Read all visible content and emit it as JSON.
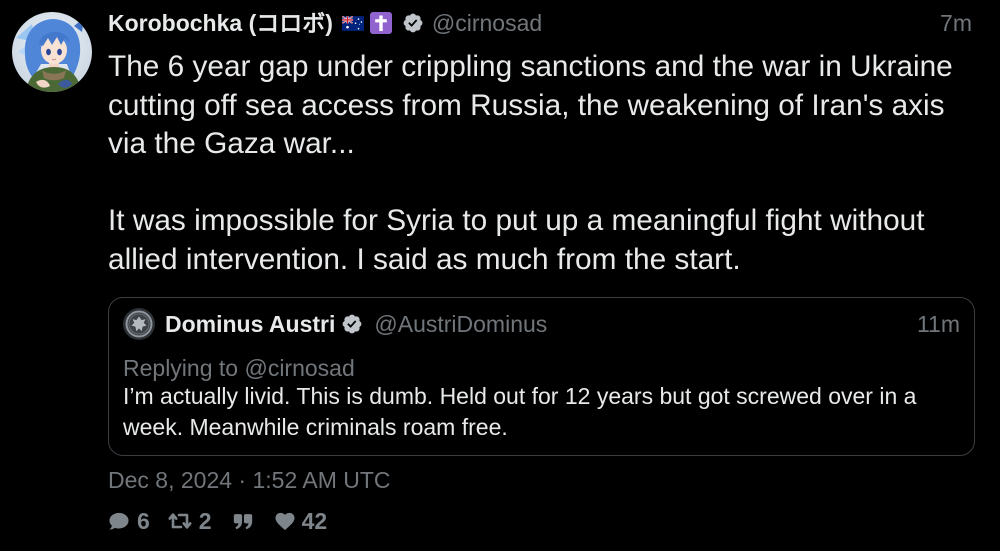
{
  "colors": {
    "background": "#000000",
    "text": "#e7e9ea",
    "muted": "#71767b",
    "stat": "#7e858b",
    "border": "#3a3e43",
    "badge": "#bfc5cb",
    "cross_badge": "#9063cf"
  },
  "tweet": {
    "author": {
      "name": "Korobochka (コロボ)",
      "handle": "@cirnosad",
      "avatar": "anime-girl-avatar",
      "badges": [
        "australia-flag-icon",
        "latin-cross-icon",
        "verified-badge-icon"
      ]
    },
    "time_ago": "7m",
    "paragraphs": [
      [
        "The 6 year gap under crippling sanctions and the war in Ukraine",
        "cutting off sea access from Russia, the weakening of Iran's axis",
        "via the Gaza war..."
      ],
      [
        "It was impossible for Syria to put up a meaningful fight without",
        "allied intervention. I said as much from the start."
      ]
    ],
    "quoted": {
      "name": "Dominus Austri",
      "handle": "@AustriDominus",
      "avatar": "emblem-avatar",
      "badges": [
        "verified-badge-icon"
      ],
      "time_ago": "11m",
      "replying_label": "Replying to",
      "replying_to": "@cirnosad",
      "lines": [
        "I’m actually livid. This is dumb. Held out for 12 years but got screwed over in a",
        "week. Meanwhile criminals roam free."
      ]
    },
    "timestamp": "Dec 8, 2024 · 1:52 AM UTC",
    "stats": {
      "replies": "6",
      "retweets": "2",
      "likes": "42",
      "icons": [
        "speech-bubble-icon",
        "retweet-icon",
        "quote-icon",
        "heart-icon"
      ]
    }
  }
}
